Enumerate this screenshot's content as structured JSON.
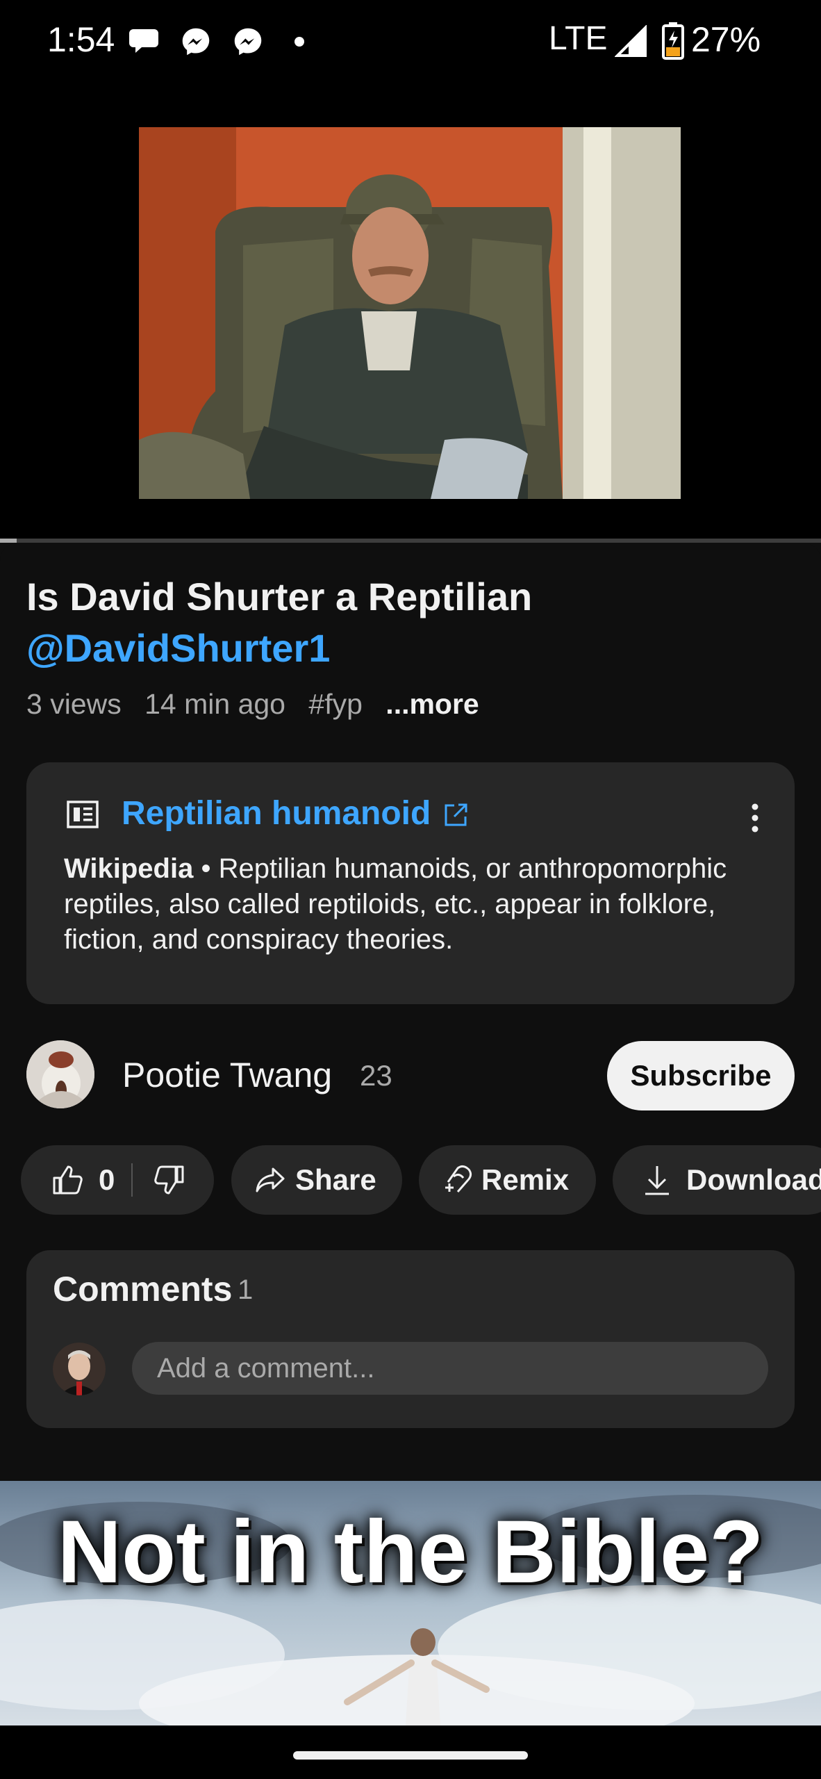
{
  "status_bar": {
    "time": "1:54",
    "network": "LTE",
    "battery": "27%",
    "icons": [
      "chat-bubble-icon",
      "messenger-icon",
      "messenger-icon",
      "dot-icon",
      "signal-icon",
      "battery-charging-icon"
    ]
  },
  "video": {
    "progress_fraction": 0.02
  },
  "details": {
    "title": "Is David Shurter a Reptilian",
    "title_mention": "@DavidShurter1",
    "views": "3 views",
    "age": "14 min ago",
    "hashtag": "#fyp",
    "more": "...more"
  },
  "info_card": {
    "icon": "article-icon",
    "title": "Reptilian humanoid",
    "external_icon": "external-link-icon",
    "source": "Wikipedia",
    "separator": " • ",
    "body": "Reptilian humanoids, or anthropomorphic reptiles, also called reptiloids, etc., appear in folklore, fiction, and conspiracy theories."
  },
  "channel": {
    "name": "Pootie Twang",
    "subscribers": "23",
    "subscribe_label": "Subscribe"
  },
  "actions": {
    "like_count": "0",
    "share_label": "Share",
    "remix_label": "Remix",
    "download_label": "Download"
  },
  "comments": {
    "label": "Comments",
    "count": "1",
    "placeholder": "Add a comment..."
  },
  "next_video": {
    "thumbnail_text": "Not in the Bible?"
  },
  "colors": {
    "background": "#0f0f0f",
    "card": "#272727",
    "link": "#3ea6ff",
    "secondary_text": "#aaaaaa"
  }
}
